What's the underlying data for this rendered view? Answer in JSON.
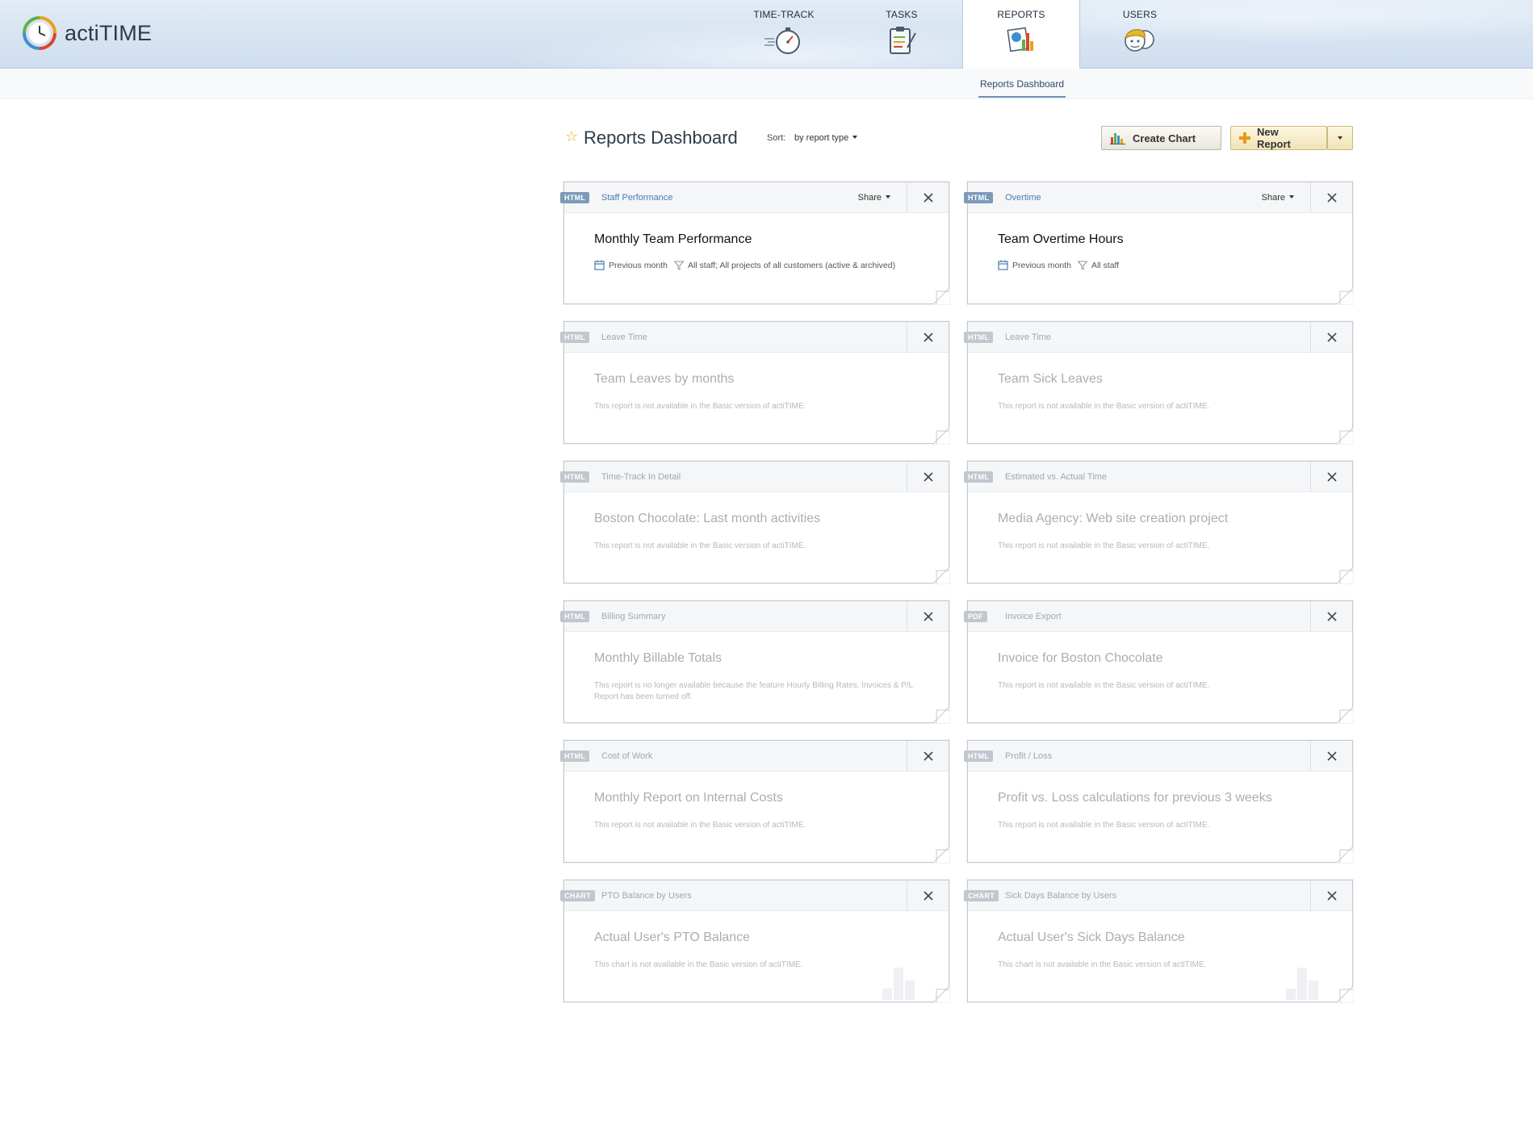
{
  "app": {
    "name": "actiTIME"
  },
  "nav": {
    "tabs": [
      {
        "label": "TIME-TRACK",
        "icon": "stopwatch-icon"
      },
      {
        "label": "TASKS",
        "icon": "clipboard-icon"
      },
      {
        "label": "REPORTS",
        "icon": "bar-chart-icon",
        "active": true
      },
      {
        "label": "USERS",
        "icon": "users-icon"
      }
    ],
    "subnav": {
      "active": "Reports Dashboard"
    }
  },
  "page": {
    "title": "Reports Dashboard",
    "sort_label": "Sort:",
    "sort_value": "by report type",
    "create_chart_label": "Create Chart",
    "new_report_label": "New Report"
  },
  "cards": [
    {
      "badge": "HTML",
      "type": "Staff Performance",
      "title": "Monthly Team Performance",
      "available": true,
      "share": "Share",
      "period": "Previous month",
      "filter": "All staff; All projects of all customers (active & archived)"
    },
    {
      "badge": "HTML",
      "type": "Overtime",
      "title": "Team Overtime Hours",
      "available": true,
      "share": "Share",
      "period": "Previous month",
      "filter": "All staff"
    },
    {
      "badge": "HTML",
      "type": "Leave Time",
      "title": "Team Leaves by months",
      "available": false,
      "note": "This report is not available in the Basic version of actiTIME."
    },
    {
      "badge": "HTML",
      "type": "Leave Time",
      "title": "Team Sick Leaves",
      "available": false,
      "note": "This report is not available in the Basic version of actiTIME."
    },
    {
      "badge": "HTML",
      "type": "Time-Track In Detail",
      "title": "Boston Chocolate: Last month activities",
      "available": false,
      "note": "This report is not available in the Basic version of actiTIME."
    },
    {
      "badge": "HTML",
      "type": "Estimated vs. Actual Time",
      "title": "Media Agency: Web site creation project",
      "available": false,
      "note": "This report is not available in the Basic version of actiTIME."
    },
    {
      "badge": "HTML",
      "type": "Billing Summary",
      "title": "Monthly Billable Totals",
      "available": false,
      "note": "This report is no longer available because the feature Hourly Billing Rates, Invoices & P/L Report has been turned off."
    },
    {
      "badge": "PDF",
      "type": "Invoice Export",
      "title": "Invoice for Boston Chocolate",
      "available": false,
      "note": "This report is not available in the Basic version of actiTIME."
    },
    {
      "badge": "HTML",
      "type": "Cost of Work",
      "title": "Monthly Report on Internal Costs",
      "available": false,
      "note": "This report is not available in the Basic version of actiTIME."
    },
    {
      "badge": "HTML",
      "type": "Profit / Loss",
      "title": "Profit vs. Loss calculations for previous 3 weeks",
      "available": false,
      "note": "This report is not available in the Basic version of actiTIME."
    },
    {
      "badge": "CHART",
      "type": "PTO Balance by Users",
      "title": "Actual User's PTO Balance",
      "available": false,
      "chart": true,
      "note": "This chart is not available in the Basic version of actiTIME."
    },
    {
      "badge": "CHART",
      "type": "Sick Days Balance by Users",
      "title": "Actual User's Sick Days Balance",
      "available": false,
      "chart": true,
      "note": "This chart is not available in the Basic version of actiTIME."
    }
  ],
  "colors": {
    "accent": "#4a7ab0",
    "badge_active": "#7d9ab8",
    "badge_inactive": "#c1c7ce",
    "star": "#e6b624"
  }
}
